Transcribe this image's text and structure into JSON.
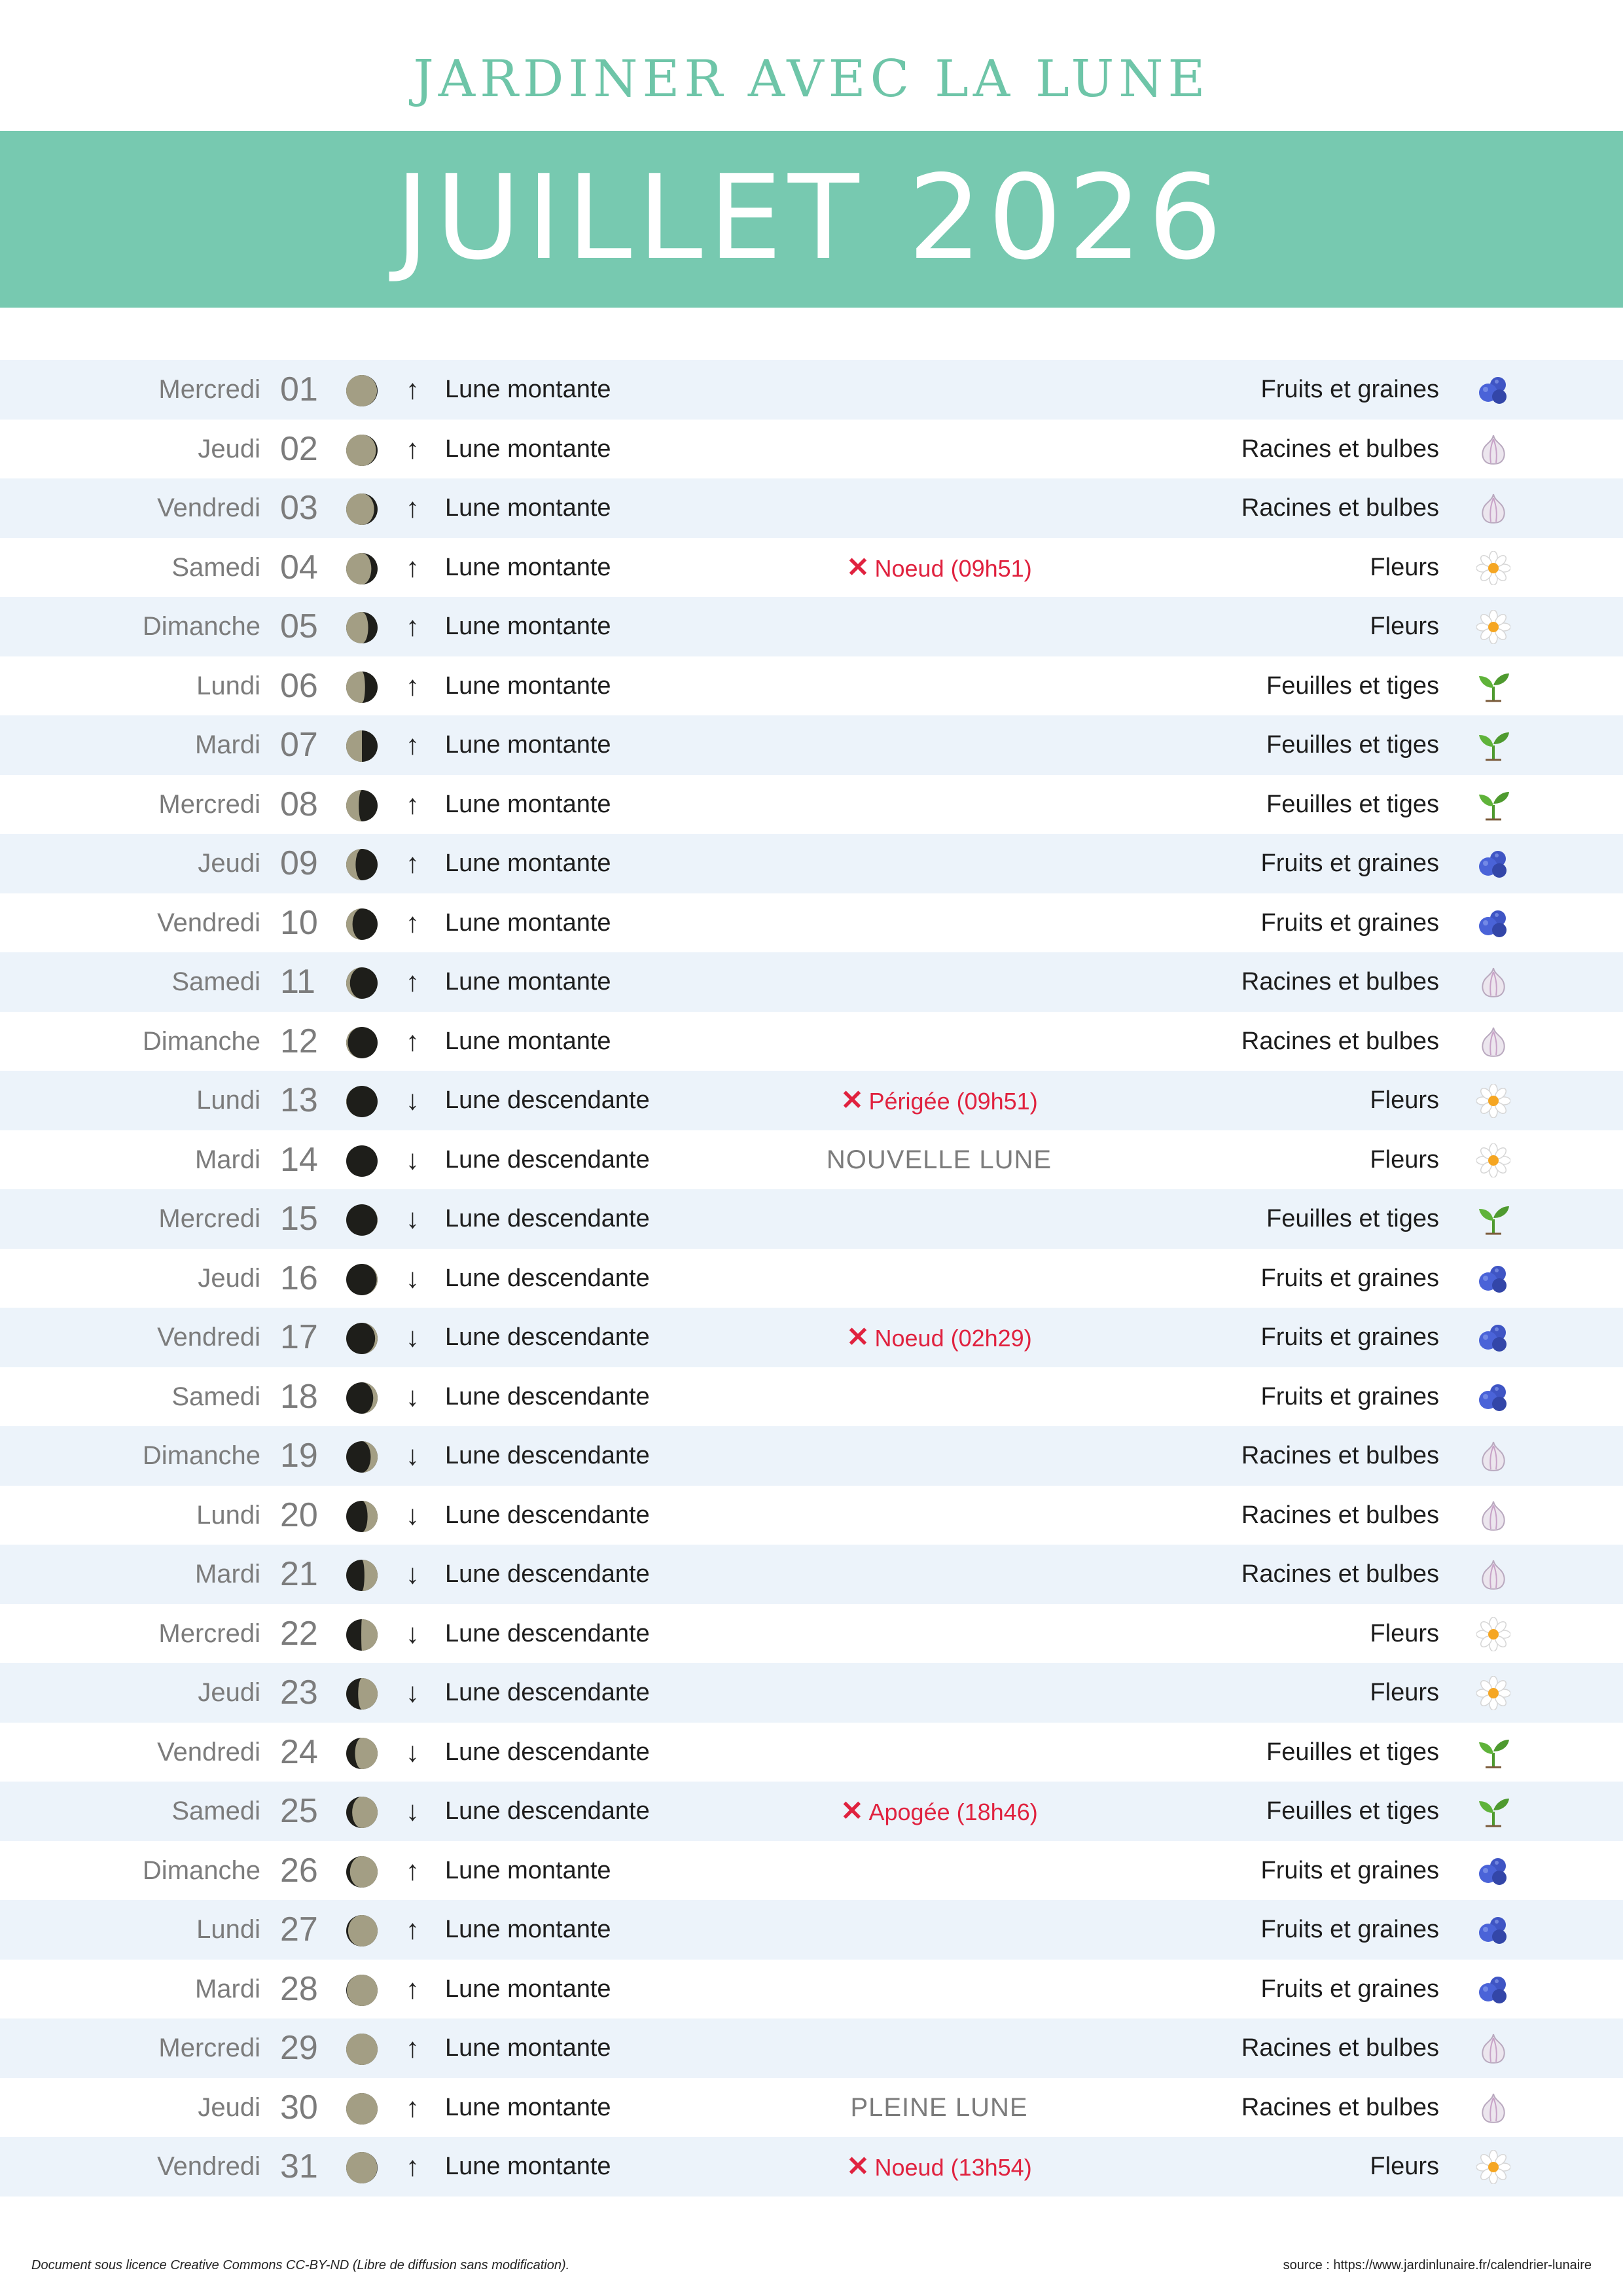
{
  "header": {
    "title": "JARDINER AVEC LA LUNE",
    "month": "JUILLET 2026"
  },
  "colors": {
    "accent": "#77c9b0",
    "title": "#6ec5a8",
    "event_red": "#e0223f",
    "moon_lit": "#a39e84",
    "moon_dark": "#1e1e1a",
    "row_alt": "#ecf3fa"
  },
  "categories": {
    "fruits": {
      "label": "Fruits et graines",
      "icon": "blueberries-icon"
    },
    "racines": {
      "label": "Racines et bulbes",
      "icon": "garlic-icon"
    },
    "fleurs": {
      "label": "Fleurs",
      "icon": "daisy-icon"
    },
    "feuilles": {
      "label": "Feuilles et tiges",
      "icon": "seedling-icon"
    }
  },
  "days": [
    {
      "name": "Mercredi",
      "num": "01",
      "trend": "Lune montante",
      "arrow": "↑",
      "illum": 0.98,
      "waxing": false,
      "event": "",
      "event_style": "",
      "cat": "Fruits et graines",
      "icon": "fruits"
    },
    {
      "name": "Jeudi",
      "num": "02",
      "trend": "Lune montante",
      "arrow": "↑",
      "illum": 0.95,
      "waxing": false,
      "event": "",
      "event_style": "",
      "cat": "Racines et bulbes",
      "icon": "racines"
    },
    {
      "name": "Vendredi",
      "num": "03",
      "trend": "Lune montante",
      "arrow": "↑",
      "illum": 0.89,
      "waxing": false,
      "event": "",
      "event_style": "",
      "cat": "Racines et bulbes",
      "icon": "racines"
    },
    {
      "name": "Samedi",
      "num": "04",
      "trend": "Lune montante",
      "arrow": "↑",
      "illum": 0.8,
      "waxing": false,
      "event": "Noeud (09h51)",
      "event_style": "red",
      "cat": "Fleurs",
      "icon": "fleurs"
    },
    {
      "name": "Dimanche",
      "num": "05",
      "trend": "Lune montante",
      "arrow": "↑",
      "illum": 0.7,
      "waxing": false,
      "event": "",
      "event_style": "",
      "cat": "Fleurs",
      "icon": "fleurs"
    },
    {
      "name": "Lundi",
      "num": "06",
      "trend": "Lune montante",
      "arrow": "↑",
      "illum": 0.6,
      "waxing": false,
      "event": "",
      "event_style": "",
      "cat": "Feuilles et tiges",
      "icon": "feuilles"
    },
    {
      "name": "Mardi",
      "num": "07",
      "trend": "Lune montante",
      "arrow": "↑",
      "illum": 0.5,
      "waxing": false,
      "event": "",
      "event_style": "",
      "cat": "Feuilles et tiges",
      "icon": "feuilles"
    },
    {
      "name": "Mercredi",
      "num": "08",
      "trend": "Lune montante",
      "arrow": "↑",
      "illum": 0.4,
      "waxing": false,
      "event": "",
      "event_style": "",
      "cat": "Feuilles et tiges",
      "icon": "feuilles"
    },
    {
      "name": "Jeudi",
      "num": "09",
      "trend": "Lune montante",
      "arrow": "↑",
      "illum": 0.3,
      "waxing": false,
      "event": "",
      "event_style": "",
      "cat": "Fruits et graines",
      "icon": "fruits"
    },
    {
      "name": "Vendredi",
      "num": "10",
      "trend": "Lune montante",
      "arrow": "↑",
      "illum": 0.2,
      "waxing": false,
      "event": "",
      "event_style": "",
      "cat": "Fruits et graines",
      "icon": "fruits"
    },
    {
      "name": "Samedi",
      "num": "11",
      "trend": "Lune montante",
      "arrow": "↑",
      "illum": 0.12,
      "waxing": false,
      "event": "",
      "event_style": "",
      "cat": "Racines et bulbes",
      "icon": "racines"
    },
    {
      "name": "Dimanche",
      "num": "12",
      "trend": "Lune montante",
      "arrow": "↑",
      "illum": 0.05,
      "waxing": false,
      "event": "",
      "event_style": "",
      "cat": "Racines et bulbes",
      "icon": "racines"
    },
    {
      "name": "Lundi",
      "num": "13",
      "trend": "Lune descendante",
      "arrow": "↓",
      "illum": 0.01,
      "waxing": false,
      "event": "Périgée (09h51)",
      "event_style": "red",
      "cat": "Fleurs",
      "icon": "fleurs"
    },
    {
      "name": "Mardi",
      "num": "14",
      "trend": "Lune descendante",
      "arrow": "↓",
      "illum": 0.0,
      "waxing": true,
      "event": "NOUVELLE LUNE",
      "event_style": "grey",
      "cat": "Fleurs",
      "icon": "fleurs"
    },
    {
      "name": "Mercredi",
      "num": "15",
      "trend": "Lune descendante",
      "arrow": "↓",
      "illum": 0.01,
      "waxing": true,
      "event": "",
      "event_style": "",
      "cat": "Feuilles et tiges",
      "icon": "feuilles"
    },
    {
      "name": "Jeudi",
      "num": "16",
      "trend": "Lune descendante",
      "arrow": "↓",
      "illum": 0.03,
      "waxing": true,
      "event": "",
      "event_style": "",
      "cat": "Fruits et graines",
      "icon": "fruits"
    },
    {
      "name": "Vendredi",
      "num": "17",
      "trend": "Lune descendante",
      "arrow": "↓",
      "illum": 0.08,
      "waxing": true,
      "event": "Noeud (02h29)",
      "event_style": "red",
      "cat": "Fruits et graines",
      "icon": "fruits"
    },
    {
      "name": "Samedi",
      "num": "18",
      "trend": "Lune descendante",
      "arrow": "↓",
      "illum": 0.14,
      "waxing": true,
      "event": "",
      "event_style": "",
      "cat": "Fruits et graines",
      "icon": "fruits"
    },
    {
      "name": "Dimanche",
      "num": "19",
      "trend": "Lune descendante",
      "arrow": "↓",
      "illum": 0.22,
      "waxing": true,
      "event": "",
      "event_style": "",
      "cat": "Racines et bulbes",
      "icon": "racines"
    },
    {
      "name": "Lundi",
      "num": "20",
      "trend": "Lune descendante",
      "arrow": "↓",
      "illum": 0.32,
      "waxing": true,
      "event": "",
      "event_style": "",
      "cat": "Racines et bulbes",
      "icon": "racines"
    },
    {
      "name": "Mardi",
      "num": "21",
      "trend": "Lune descendante",
      "arrow": "↓",
      "illum": 0.42,
      "waxing": true,
      "event": "",
      "event_style": "",
      "cat": "Racines et bulbes",
      "icon": "racines"
    },
    {
      "name": "Mercredi",
      "num": "22",
      "trend": "Lune descendante",
      "arrow": "↓",
      "illum": 0.52,
      "waxing": true,
      "event": "",
      "event_style": "",
      "cat": "Fleurs",
      "icon": "fleurs"
    },
    {
      "name": "Jeudi",
      "num": "23",
      "trend": "Lune descendante",
      "arrow": "↓",
      "illum": 0.62,
      "waxing": true,
      "event": "",
      "event_style": "",
      "cat": "Fleurs",
      "icon": "fleurs"
    },
    {
      "name": "Vendredi",
      "num": "24",
      "trend": "Lune descendante",
      "arrow": "↓",
      "illum": 0.72,
      "waxing": true,
      "event": "",
      "event_style": "",
      "cat": "Feuilles et tiges",
      "icon": "feuilles"
    },
    {
      "name": "Samedi",
      "num": "25",
      "trend": "Lune descendante",
      "arrow": "↓",
      "illum": 0.81,
      "waxing": true,
      "event": "Apogée (18h46)",
      "event_style": "red",
      "cat": "Feuilles et tiges",
      "icon": "feuilles"
    },
    {
      "name": "Dimanche",
      "num": "26",
      "trend": "Lune montante",
      "arrow": "↑",
      "illum": 0.88,
      "waxing": true,
      "event": "",
      "event_style": "",
      "cat": "Fruits et graines",
      "icon": "fruits"
    },
    {
      "name": "Lundi",
      "num": "27",
      "trend": "Lune montante",
      "arrow": "↑",
      "illum": 0.94,
      "waxing": true,
      "event": "",
      "event_style": "",
      "cat": "Fruits et graines",
      "icon": "fruits"
    },
    {
      "name": "Mardi",
      "num": "28",
      "trend": "Lune montante",
      "arrow": "↑",
      "illum": 0.98,
      "waxing": true,
      "event": "",
      "event_style": "",
      "cat": "Fruits et graines",
      "icon": "fruits"
    },
    {
      "name": "Mercredi",
      "num": "29",
      "trend": "Lune montante",
      "arrow": "↑",
      "illum": 1.0,
      "waxing": true,
      "event": "",
      "event_style": "",
      "cat": "Racines et bulbes",
      "icon": "racines"
    },
    {
      "name": "Jeudi",
      "num": "30",
      "trend": "Lune montante",
      "arrow": "↑",
      "illum": 1.0,
      "waxing": true,
      "event": "PLEINE LUNE",
      "event_style": "grey",
      "cat": "Racines et bulbes",
      "icon": "racines"
    },
    {
      "name": "Vendredi",
      "num": "31",
      "trend": "Lune montante",
      "arrow": "↑",
      "illum": 0.99,
      "waxing": false,
      "event": "Noeud (13h54)",
      "event_style": "red",
      "cat": "Fleurs",
      "icon": "fleurs"
    }
  ],
  "footer": {
    "license": "Document sous licence Creative Commons CC-BY-ND (Libre de diffusion sans modification).",
    "source": "source : https://www.jardinlunaire.fr/calendrier-lunaire"
  }
}
